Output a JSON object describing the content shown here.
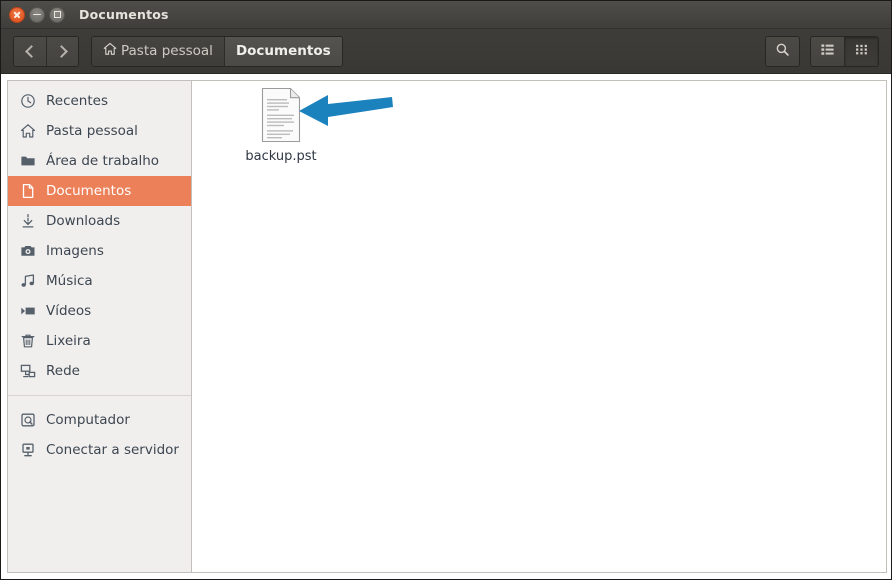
{
  "window": {
    "title": "Documentos",
    "controls": [
      {
        "name": "close",
        "glyph": "x"
      },
      {
        "name": "minimize",
        "glyph": "dash"
      },
      {
        "name": "maximize",
        "glyph": "square"
      }
    ]
  },
  "toolbar": {
    "back_label": "",
    "forward_label": "",
    "search_label": "",
    "list_view_label": "",
    "grid_view_label": "",
    "breadcrumbs": [
      {
        "label": "Pasta pessoal",
        "icon": "home-icon",
        "current": false
      },
      {
        "label": "Documentos",
        "icon": "",
        "current": true
      }
    ]
  },
  "sidebar": {
    "items": [
      {
        "label": "Recentes",
        "icon": "clock-icon",
        "selected": false
      },
      {
        "label": "Pasta pessoal",
        "icon": "home-icon",
        "selected": false
      },
      {
        "label": "Área de trabalho",
        "icon": "folder-icon",
        "selected": false
      },
      {
        "label": "Documentos",
        "icon": "document-icon",
        "selected": true
      },
      {
        "label": "Downloads",
        "icon": "download-icon",
        "selected": false
      },
      {
        "label": "Imagens",
        "icon": "camera-icon",
        "selected": false
      },
      {
        "label": "Música",
        "icon": "music-note-icon",
        "selected": false
      },
      {
        "label": "Vídeos",
        "icon": "video-icon",
        "selected": false
      },
      {
        "label": "Lixeira",
        "icon": "trash-icon",
        "selected": false
      },
      {
        "label": "Rede",
        "icon": "network-icon",
        "selected": false
      }
    ],
    "items_secondary": [
      {
        "label": "Computador",
        "icon": "harddrive-icon",
        "selected": false
      },
      {
        "label": "Conectar a servidor",
        "icon": "server-connect-icon",
        "selected": false
      }
    ]
  },
  "files": [
    {
      "name": "backup.pst",
      "icon": "text-document-icon",
      "selected": false
    }
  ],
  "annotation": {
    "type": "arrow",
    "direction": "left",
    "points_to": "backup.pst",
    "color": "#1b82bd"
  },
  "colors": {
    "selection_orange": "#ec8159",
    "titlebar_dark": "#47453f",
    "sidebar_bg": "#f1efee",
    "content_bg": "#ffffff",
    "arrow_blue": "#1b82bd",
    "close_button": "#df5822"
  }
}
